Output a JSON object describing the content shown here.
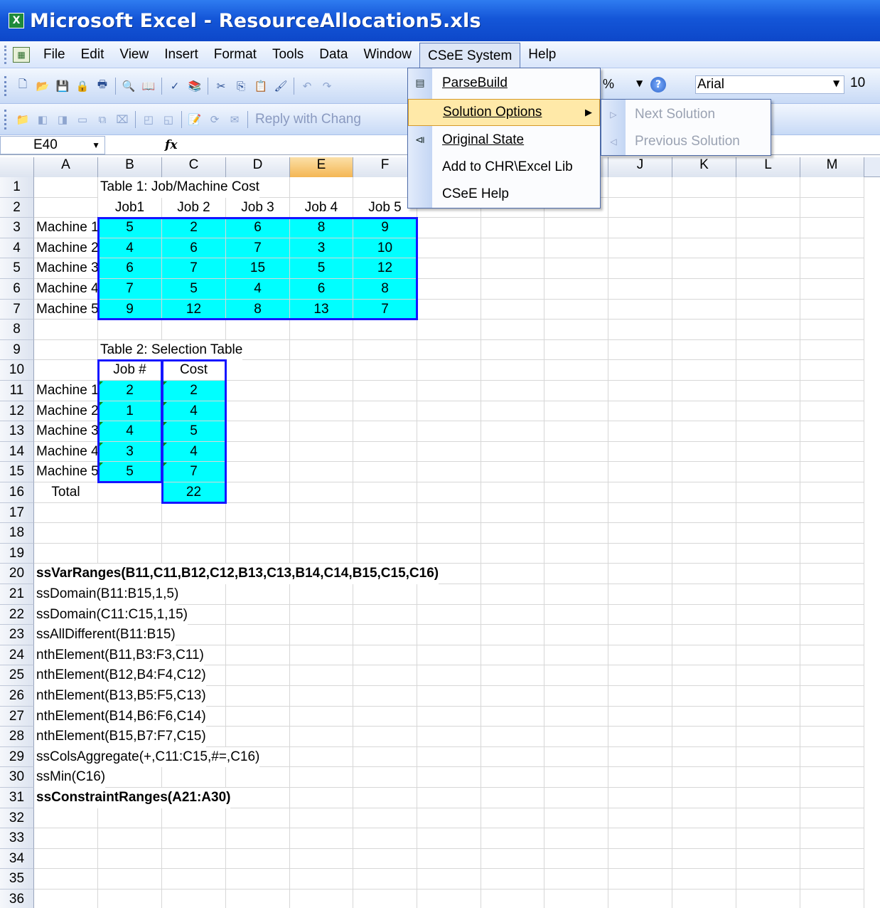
{
  "window": {
    "title": "Microsoft Excel - ResourceAllocation5.xls",
    "app_icon": "excel-icon"
  },
  "menubar": {
    "items": [
      "File",
      "Edit",
      "View",
      "Insert",
      "Format",
      "Tools",
      "Data",
      "Window",
      "CSeE System",
      "Help"
    ],
    "active": "CSeE System"
  },
  "toolbar": {
    "reply_label": "Reply with Chang",
    "zoom_suffix": "%",
    "font_name": "Arial",
    "font_size": "10"
  },
  "formula_bar": {
    "name_box": "E40",
    "fx_label": "fx",
    "formula": ""
  },
  "columns": [
    "A",
    "B",
    "C",
    "D",
    "E",
    "F",
    "G",
    "H",
    "I",
    "J",
    "K",
    "L",
    "M"
  ],
  "selected_column": "E",
  "rows": {
    "1": {
      "B": "Table 1: Job/Machine Cost"
    },
    "2": {
      "B": "Job1",
      "C": "Job 2",
      "D": "Job 3",
      "E": "Job 4",
      "F": "Job 5"
    },
    "3": {
      "A": "Machine 1",
      "B": "5",
      "C": "2",
      "D": "6",
      "E": "8",
      "F": "9"
    },
    "4": {
      "A": "Machine 2",
      "B": "4",
      "C": "6",
      "D": "7",
      "E": "3",
      "F": "10"
    },
    "5": {
      "A": "Machine 3",
      "B": "6",
      "C": "7",
      "D": "15",
      "E": "5",
      "F": "12"
    },
    "6": {
      "A": "Machine 4",
      "B": "7",
      "C": "5",
      "D": "4",
      "E": "6",
      "F": "8"
    },
    "7": {
      "A": "Machine 5",
      "B": "9",
      "C": "12",
      "D": "8",
      "E": "13",
      "F": "7"
    },
    "9": {
      "B": "Table 2: Selection Table"
    },
    "10": {
      "B": "Job #",
      "C": "Cost"
    },
    "11": {
      "A": "Machine 1",
      "B": "2",
      "C": "2"
    },
    "12": {
      "A": "Machine 2",
      "B": "1",
      "C": "4"
    },
    "13": {
      "A": "Machine 3",
      "B": "4",
      "C": "5"
    },
    "14": {
      "A": "Machine 4",
      "B": "3",
      "C": "4"
    },
    "15": {
      "A": "Machine 5",
      "B": "5",
      "C": "7"
    },
    "16": {
      "A": "Total",
      "C": "22"
    },
    "20": {
      "A": "ssVarRanges(B11,C11,B12,C12,B13,C13,B14,C14,B15,C15,C16)"
    },
    "21": {
      "A": "ssDomain(B11:B15,1,5)"
    },
    "22": {
      "A": "ssDomain(C11:C15,1,15)"
    },
    "23": {
      "A": "ssAllDifferent(B11:B15)"
    },
    "24": {
      "A": "nthElement(B11,B3:F3,C11)"
    },
    "25": {
      "A": "nthElement(B12,B4:F4,C12)"
    },
    "26": {
      "A": "nthElement(B13,B5:F5,C13)"
    },
    "27": {
      "A": "nthElement(B14,B6:F6,C14)"
    },
    "28": {
      "A": "nthElement(B15,B7:F7,C15)"
    },
    "29": {
      "A": "ssColsAggregate(+,C11:C15,#=,C16)"
    },
    "30": {
      "A": "ssMin(C16)"
    },
    "31": {
      "A": "ssConstraintRanges(A21:A30)"
    }
  },
  "row_count": 36,
  "csee_menu": {
    "items": [
      {
        "label": "ParseBuild",
        "icon": "parse-build-icon"
      },
      {
        "label": "Solution Options",
        "has_submenu": true
      },
      {
        "label": "Original State",
        "icon": "original-state-icon"
      },
      {
        "label": "Add to CHR\\Excel Lib"
      },
      {
        "label": "CSeE Help"
      }
    ],
    "highlighted": "Solution Options"
  },
  "solution_submenu": {
    "items": [
      {
        "label": "Next Solution",
        "icon": "next-arrow-icon",
        "disabled": true
      },
      {
        "label": "Previous Solution",
        "icon": "prev-arrow-icon",
        "disabled": true
      }
    ]
  },
  "colors": {
    "cell_fill": "#00ffff",
    "table_border": "#1515ff",
    "menu_highlight": "#ffe9a8",
    "title_bar": "#1456d8"
  }
}
